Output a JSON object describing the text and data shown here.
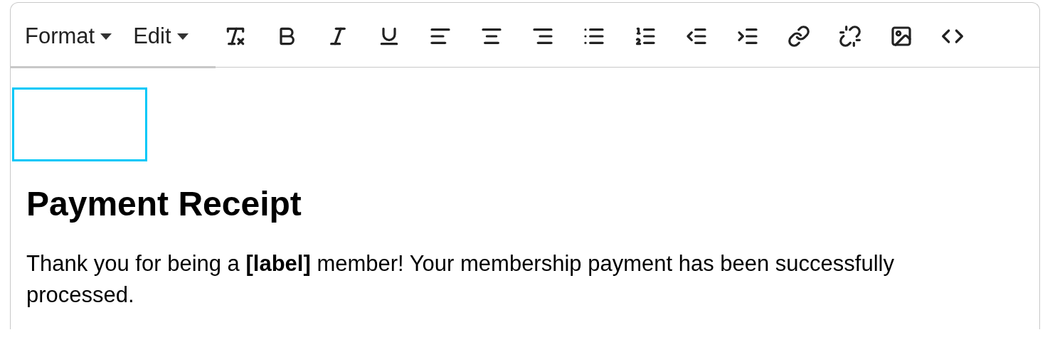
{
  "menus": [
    {
      "label": "Format"
    },
    {
      "label": "Edit"
    }
  ],
  "toolbar": [
    {
      "kind": "clear-format"
    },
    {
      "kind": "bold"
    },
    {
      "kind": "italic"
    },
    {
      "kind": "underline"
    },
    {
      "kind": "align-left"
    },
    {
      "kind": "align-center"
    },
    {
      "kind": "align-right"
    },
    {
      "kind": "bullet-list"
    },
    {
      "kind": "numbered-list"
    },
    {
      "kind": "outdent"
    },
    {
      "kind": "indent"
    },
    {
      "kind": "link"
    },
    {
      "kind": "unlink"
    },
    {
      "kind": "image"
    },
    {
      "kind": "code"
    }
  ],
  "content": {
    "heading": "Payment Receipt",
    "paragraph": "Thank you for being a **[label]** member! Your membership payment has been successfully processed."
  }
}
